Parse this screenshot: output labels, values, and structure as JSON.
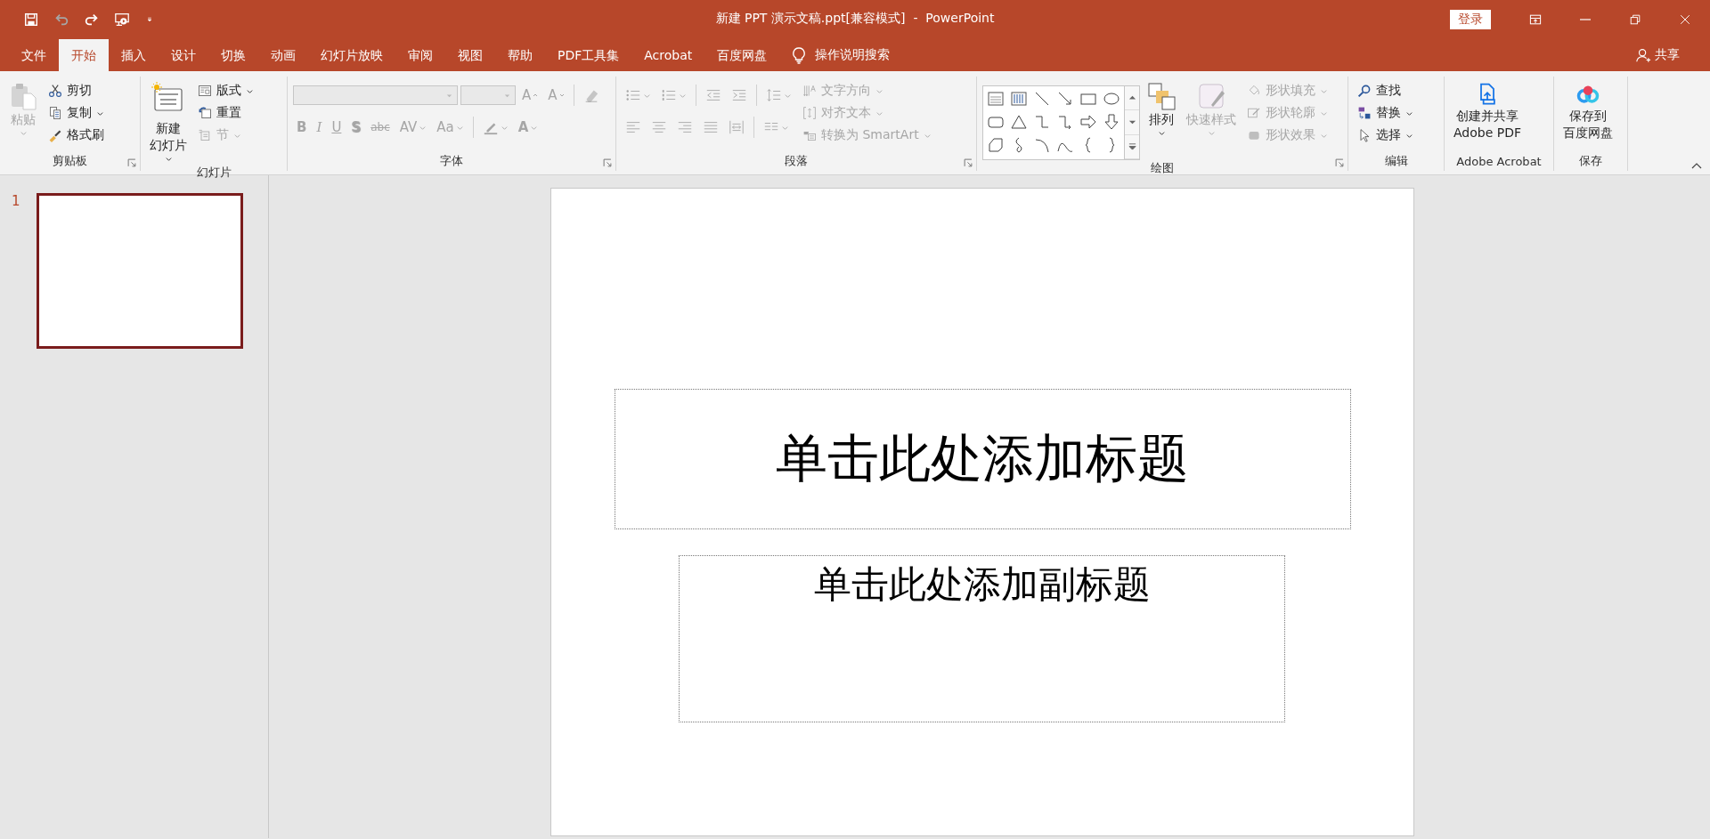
{
  "window": {
    "title": "新建 PPT 演示文稿.ppt[兼容模式]  -  PowerPoint",
    "sign_in": "登录"
  },
  "quick_access": [
    {
      "disabled": false
    },
    {
      "disabled": true
    },
    {
      "disabled": false
    },
    {
      "disabled": false
    },
    {
      "disabled": false
    }
  ],
  "tabs": [
    {
      "label": "文件",
      "selected": false
    },
    {
      "label": "开始",
      "selected": true
    },
    {
      "label": "插入",
      "selected": false
    },
    {
      "label": "设计",
      "selected": false
    },
    {
      "label": "切换",
      "selected": false
    },
    {
      "label": "动画",
      "selected": false
    },
    {
      "label": "幻灯片放映",
      "selected": false
    },
    {
      "label": "审阅",
      "selected": false
    },
    {
      "label": "视图",
      "selected": false
    },
    {
      "label": "帮助",
      "selected": false
    },
    {
      "label": "PDF工具集",
      "selected": false
    },
    {
      "label": "Acrobat",
      "selected": false
    },
    {
      "label": "百度网盘",
      "selected": false
    }
  ],
  "tell_me": "操作说明搜索",
  "share": "共享",
  "ribbon": {
    "groups": [
      {
        "name": "剪贴板",
        "launcher": true,
        "items": [
          {
            "label": "粘贴",
            "dropdown": true,
            "disabled": true
          },
          {
            "label": "剪切",
            "dropdown": false,
            "disabled": false
          },
          {
            "label": "复制",
            "dropdown": true,
            "disabled": false
          },
          {
            "label": "格式刷",
            "dropdown": false,
            "disabled": false
          }
        ]
      },
      {
        "name": "幻灯片",
        "launcher": false,
        "items": [
          {
            "lines": [
              "新建",
              "幻灯片"
            ],
            "dropdown": true,
            "disabled": false
          },
          {
            "label": "版式",
            "dropdown": true,
            "disabled": false
          },
          {
            "label": "重置",
            "dropdown": false,
            "disabled": false
          },
          {
            "label": "节",
            "dropdown": true,
            "disabled": true
          }
        ]
      },
      {
        "name": "字体",
        "launcher": true,
        "items": [
          {
            "disabled": true
          },
          {
            "disabled": true
          },
          {
            "text": "A",
            "dropdown": false,
            "disabled": true
          },
          {
            "text": "A",
            "dropdown": false,
            "disabled": true
          },
          {
            "disabled": true
          },
          {
            "text": "B",
            "dropdown": false,
            "disabled": true
          },
          {
            "text": "I",
            "dropdown": false,
            "disabled": true
          },
          {
            "text": "U",
            "dropdown": false,
            "disabled": true
          },
          {
            "text": "S",
            "dropdown": false,
            "disabled": true
          },
          {
            "text": "abc",
            "dropdown": false,
            "disabled": true
          },
          {
            "text": "AV",
            "dropdown": true,
            "disabled": true
          },
          {
            "text": "Aa",
            "dropdown": true,
            "disabled": true
          },
          {
            "dropdown": true,
            "disabled": true
          },
          {
            "text": "A",
            "dropdown": true,
            "disabled": true
          }
        ]
      },
      {
        "name": "段落",
        "launcher": true,
        "items": [
          {
            "dropdown": true,
            "disabled": true
          },
          {
            "dropdown": true,
            "disabled": true
          },
          {
            "dropdown": false,
            "disabled": true
          },
          {
            "dropdown": false,
            "disabled": true
          },
          {
            "dropdown": true,
            "disabled": true
          },
          {
            "dropdown": false,
            "disabled": true
          },
          {
            "dropdown": false,
            "disabled": true
          },
          {
            "dropdown": false,
            "disabled": true
          },
          {
            "dropdown": false,
            "disabled": true
          },
          {
            "dropdown": false,
            "disabled": true
          },
          {
            "dropdown": true,
            "disabled": true
          },
          {
            "label": "文字方向",
            "dropdown": true,
            "disabled": true
          },
          {
            "label": "对齐文本",
            "dropdown": true,
            "disabled": true
          },
          {
            "label": "转换为 SmartArt",
            "dropdown": true,
            "disabled": true
          }
        ]
      },
      {
        "name": "绘图",
        "launcher": true,
        "items": [
          {
            "lines": [
              "排列"
            ],
            "dropdown": true,
            "disabled": false
          },
          {
            "lines": [
              "快速样式"
            ],
            "dropdown": true,
            "disabled": true
          },
          {
            "label": "形状填充",
            "dropdown": true,
            "disabled": true
          },
          {
            "label": "形状轮廓",
            "dropdown": true,
            "disabled": true
          },
          {
            "label": "形状效果",
            "dropdown": true,
            "disabled": true
          }
        ]
      },
      {
        "name": "编辑",
        "launcher": false,
        "items": [
          {
            "label": "查找",
            "dropdown": false,
            "disabled": false
          },
          {
            "label": "替换",
            "dropdown": true,
            "disabled": false
          },
          {
            "label": "选择",
            "dropdown": true,
            "disabled": false
          }
        ]
      },
      {
        "name": "Adobe Acrobat",
        "launcher": false,
        "items": [
          {
            "lines": [
              "创建并共享",
              "Adobe PDF"
            ],
            "dropdown": false,
            "disabled": false
          }
        ]
      },
      {
        "name": "保存",
        "launcher": false,
        "items": [
          {
            "lines": [
              "保存到",
              "百度网盘"
            ],
            "dropdown": false,
            "disabled": false
          }
        ]
      }
    ]
  },
  "slides": [
    {
      "number": "1",
      "selected": true
    }
  ],
  "slide": {
    "title": "单击此处添加标题",
    "subtitle": "单击此处添加副标题"
  }
}
